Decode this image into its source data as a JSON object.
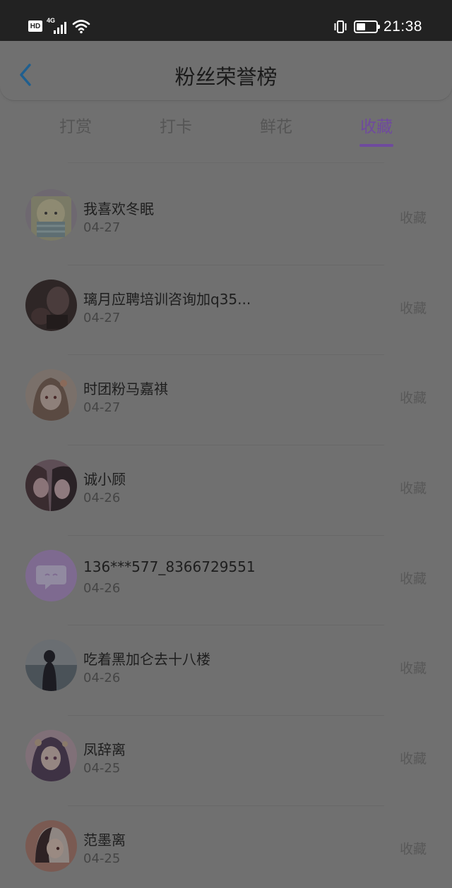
{
  "status_bar": {
    "hd_label": "HD",
    "network_label": "4G",
    "wifi_icon": "wifi-icon",
    "vibrate_icon": "vibrate-icon",
    "battery_level": 0.45,
    "time": "21:38"
  },
  "header": {
    "back_icon": "chevron-left-icon",
    "title": "粉丝荣誉榜"
  },
  "tabs": [
    {
      "label": "打赏",
      "active": false
    },
    {
      "label": "打卡",
      "active": false
    },
    {
      "label": "鲜花",
      "active": false
    },
    {
      "label": "收藏",
      "active": true
    }
  ],
  "colors": {
    "accent": "#6f4a9e",
    "back_icon": "#1f5f8f",
    "overlay_background": "#707070",
    "status_bar": "#222222"
  },
  "fans": [
    {
      "name": "我喜欢冬眠",
      "date": "04-27",
      "action": "收藏",
      "avatar": "avatar-cartoon"
    },
    {
      "name": "璃月应聘培训咨询加q35...",
      "date": "04-27",
      "action": "收藏",
      "avatar": "avatar-dark-photo"
    },
    {
      "name": "时团粉马嘉祺",
      "date": "04-27",
      "action": "收藏",
      "avatar": "avatar-anime-girl"
    },
    {
      "name": "诚小顾",
      "date": "04-26",
      "action": "收藏",
      "avatar": "avatar-two-girls"
    },
    {
      "name": "136***577_8366729551",
      "date": "04-26",
      "action": "收藏",
      "avatar": "avatar-default-chat-icon"
    },
    {
      "name": "吃着黑加仑去十八楼",
      "date": "04-26",
      "action": "收藏",
      "avatar": "avatar-silhouette-photo"
    },
    {
      "name": "凤辞离",
      "date": "04-25",
      "action": "收藏",
      "avatar": "avatar-anime-character"
    },
    {
      "name": "范墨离",
      "date": "04-25",
      "action": "收藏",
      "avatar": "avatar-anime-boy"
    }
  ]
}
